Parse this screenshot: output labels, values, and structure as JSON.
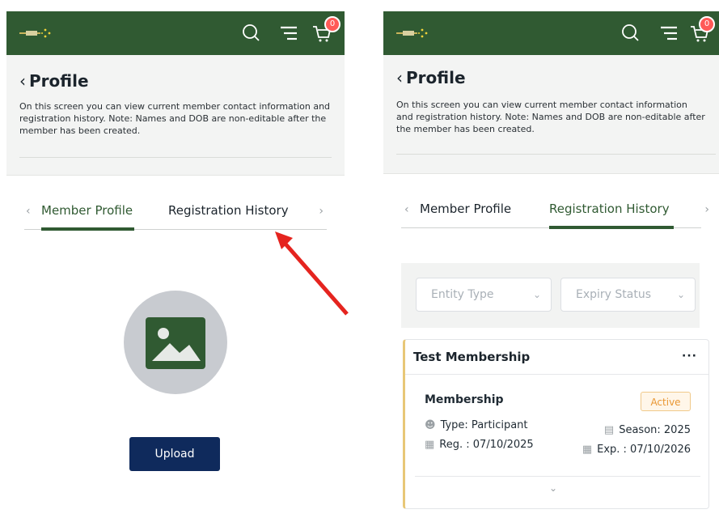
{
  "header": {
    "cart_count": "0"
  },
  "left": {
    "title": "Profile",
    "description": "On this screen you can view current member contact information and registration history. Note: Names and DOB are non-editable after the member has been created.",
    "tabs": [
      {
        "label": "Member Profile",
        "active": true
      },
      {
        "label": "Registration History",
        "active": false
      }
    ],
    "upload_label": "Upload"
  },
  "right": {
    "title": "Profile",
    "description": "On this screen you can view current member contact information and registration history. Note: Names and DOB are non-editable after the member has been created.",
    "tabs": [
      {
        "label": "Member Profile",
        "active": false
      },
      {
        "label": "Registration History",
        "active": true
      }
    ],
    "filters": {
      "entity_type": "Entity Type",
      "expiry_status": "Expiry Status"
    },
    "membership_card": {
      "title": "Test Membership",
      "name": "Membership",
      "status": "Active",
      "type": "Type: Participant",
      "season": "Season: 2025",
      "reg": "Reg. : 07/10/2025",
      "exp": "Exp. : 07/10/2026"
    }
  },
  "colors": {
    "header": "#305a32",
    "accent": "#305a32",
    "upload": "#0f2a5c",
    "active_badge": "#e99733",
    "annotation_arrow": "#e5241f"
  },
  "icons": [
    "logo",
    "search-icon",
    "menu-icon",
    "cart-icon",
    "chevron-left-icon",
    "chevron-right-icon",
    "image-icon",
    "chevron-down-icon",
    "more-icon",
    "user-icon",
    "calendar-icon",
    "clipboard-icon"
  ]
}
